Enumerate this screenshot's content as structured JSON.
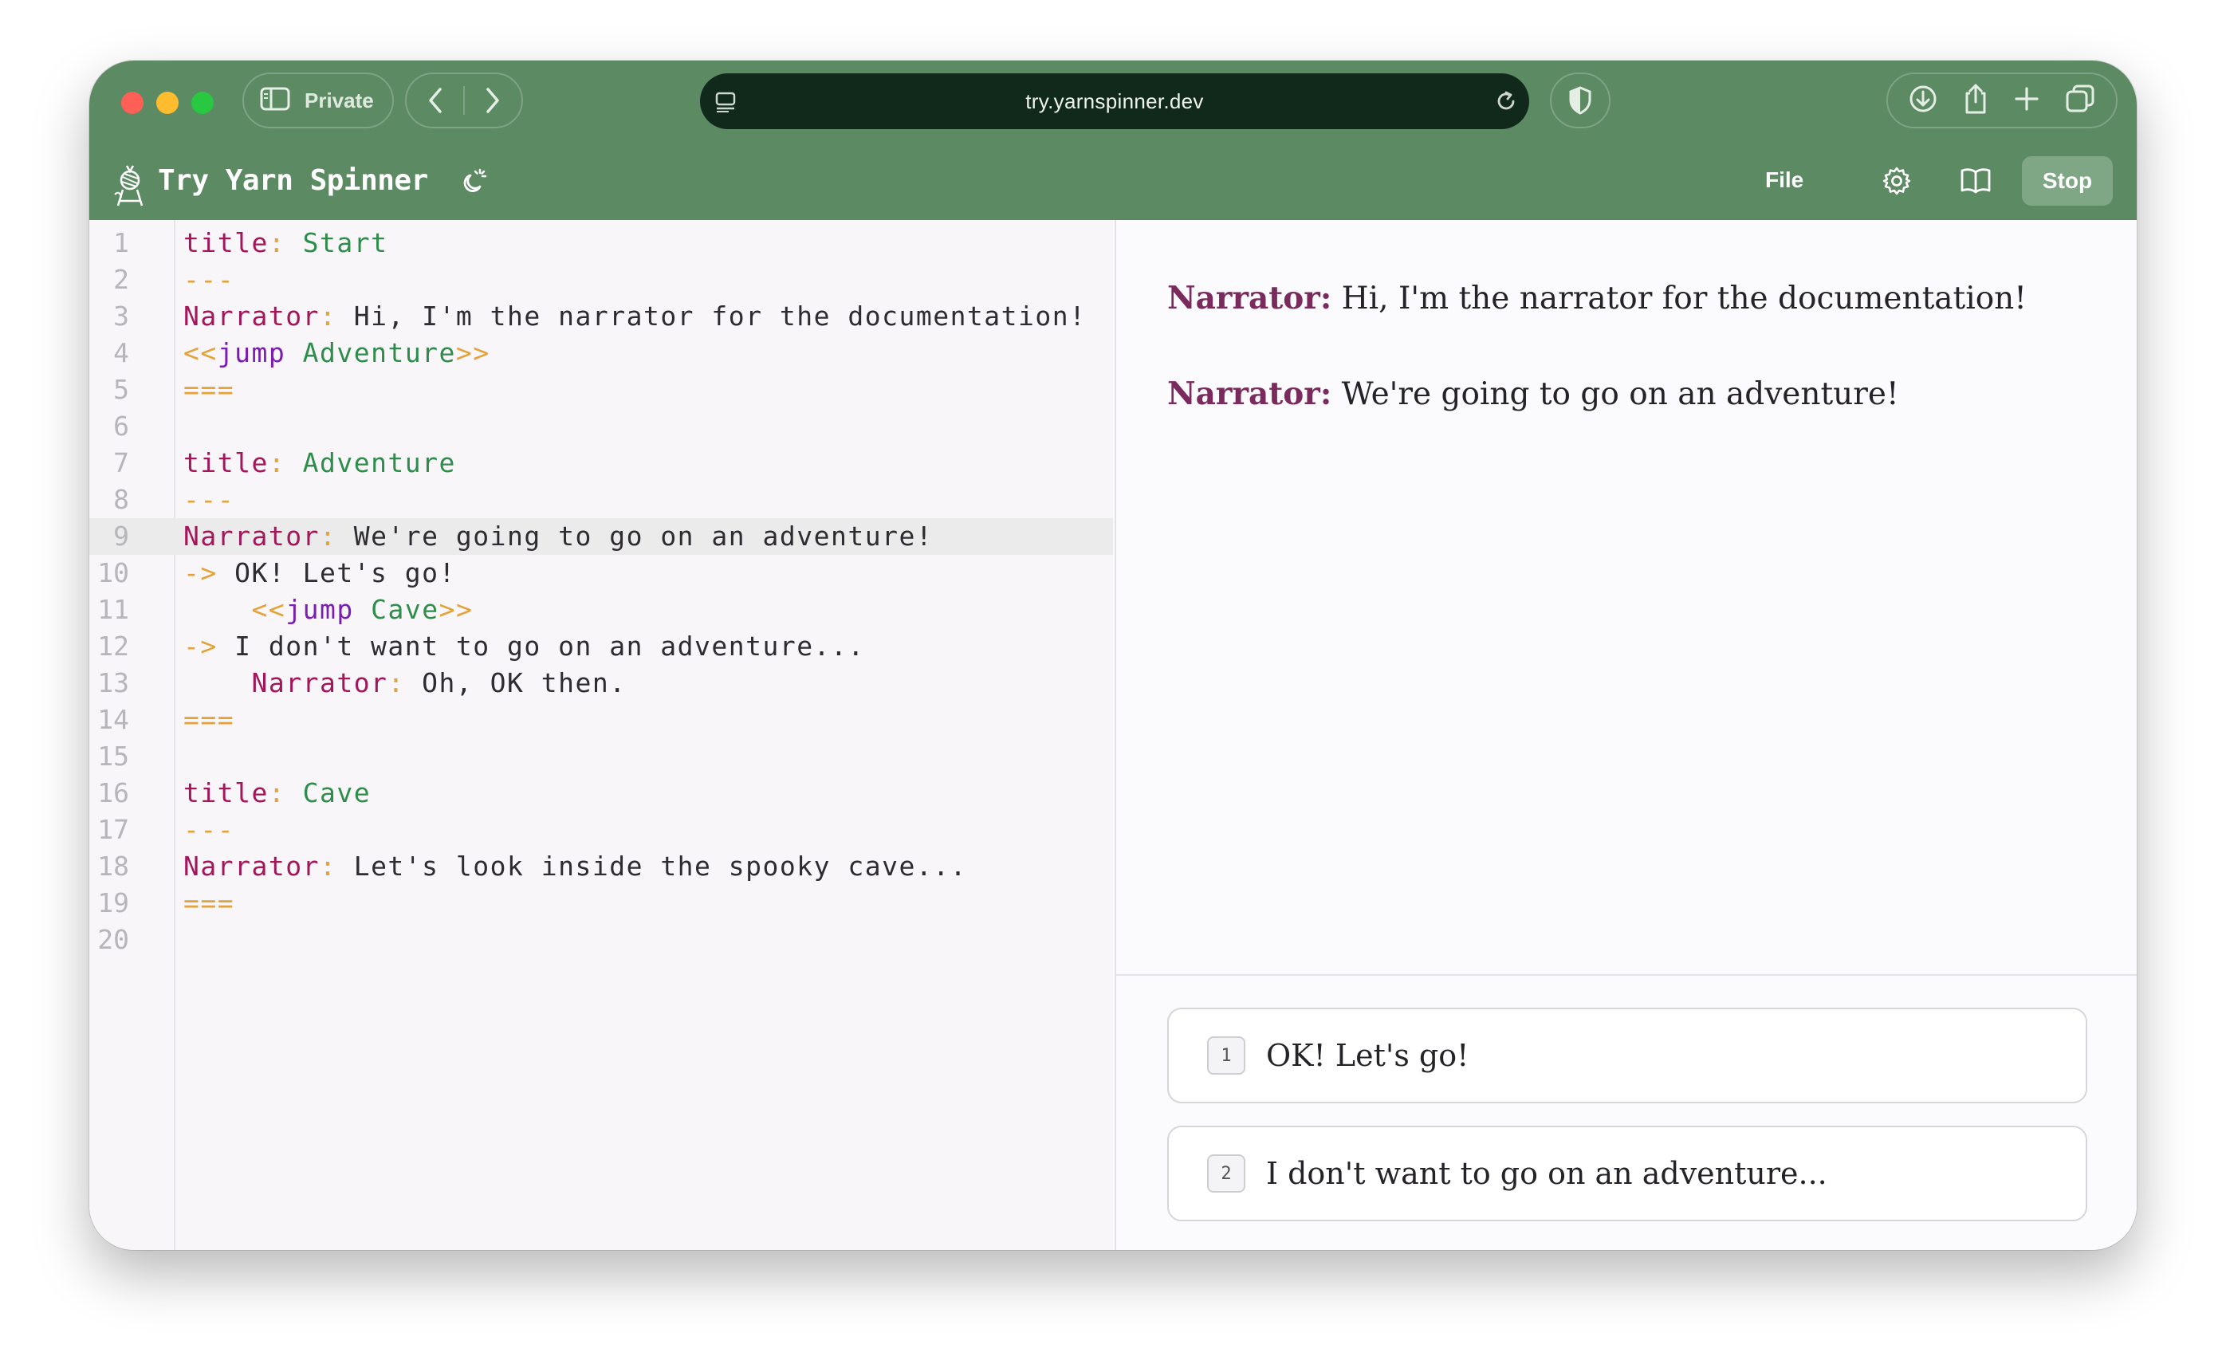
{
  "browser": {
    "private_label": "Private",
    "url": "try.yarnspinner.dev"
  },
  "app": {
    "title": "Try Yarn Spinner",
    "file_label": "File",
    "stop_label": "Stop"
  },
  "editor": {
    "active_line": 9,
    "lines": [
      {
        "n": "1"
      },
      {
        "n": "2"
      },
      {
        "n": "3"
      },
      {
        "n": "4"
      },
      {
        "n": "5"
      },
      {
        "n": "6"
      },
      {
        "n": "7"
      },
      {
        "n": "8"
      },
      {
        "n": "9"
      },
      {
        "n": "10"
      },
      {
        "n": "11"
      },
      {
        "n": "12"
      },
      {
        "n": "13"
      },
      {
        "n": "14"
      },
      {
        "n": "15"
      },
      {
        "n": "16"
      },
      {
        "n": "17"
      },
      {
        "n": "18"
      },
      {
        "n": "19"
      },
      {
        "n": "20"
      }
    ],
    "tokens": {
      "title_key": "title",
      "colon": ":",
      "sep_start": "---",
      "sep_end": "===",
      "speaker": "Narrator",
      "arrow": "->",
      "cmd_open": "<<",
      "cmd_close": ">>",
      "jump": "jump",
      "node_start": "Start",
      "node_adventure": "Adventure",
      "node_cave": "Cave",
      "l3_text": " Hi, I'm the narrator for the documentation!",
      "l9_text": " We're going to go on an adventure!",
      "l10_text": " OK! Let's go!",
      "l12_text": " I don't want to go on an adventure...",
      "l13_text": " Oh, OK then.",
      "l18_text": " Let's look inside the spooky cave..."
    }
  },
  "preview": {
    "dialogue": [
      {
        "speaker": "Narrator:",
        "text": " Hi, I'm the narrator for the documentation!"
      },
      {
        "speaker": "Narrator:",
        "text": " We're going to go on an adventure!"
      }
    ],
    "options": [
      {
        "num": "1",
        "text": "OK! Let's go!"
      },
      {
        "num": "2",
        "text": "I don't want to go on an adventure..."
      }
    ]
  }
}
